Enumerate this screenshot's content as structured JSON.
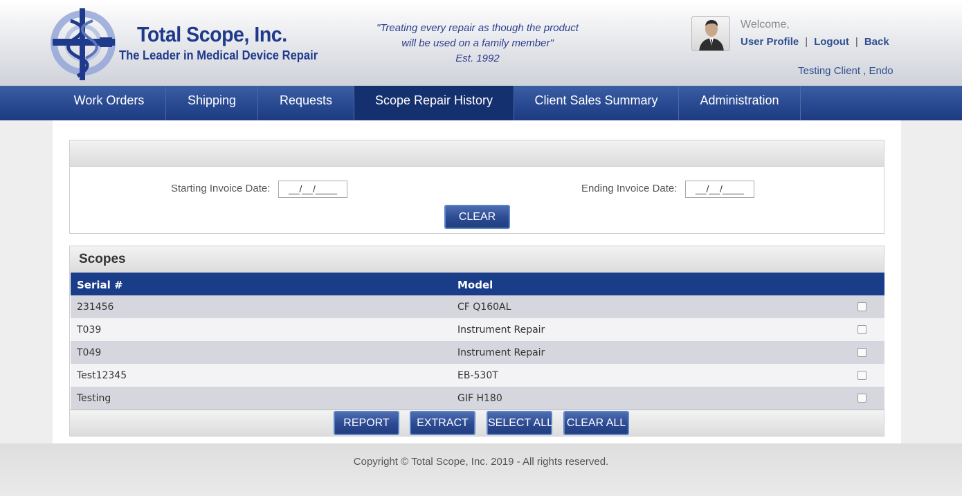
{
  "header": {
    "company_name": "Total Scope, Inc.",
    "company_tagline": "The Leader in Medical Device Repair",
    "motto_line1": "\"Treating every repair as though the product",
    "motto_line2": "will be used on a family member\"",
    "motto_line3": "Est. 1992",
    "welcome": "Welcome,",
    "user_profile": "User Profile",
    "separator": "|",
    "logout": "Logout",
    "back": "Back",
    "client_name": "Testing Client , Endo"
  },
  "nav": {
    "items": [
      {
        "label": "Work Orders"
      },
      {
        "label": "Shipping"
      },
      {
        "label": "Requests"
      },
      {
        "label": "Scope Repair History",
        "active": true
      },
      {
        "label": "Client Sales Summary"
      },
      {
        "label": "Administration"
      }
    ]
  },
  "filters": {
    "start_label": "Starting Invoice Date:",
    "start_value": "__/__/____",
    "end_label": "Ending Invoice Date:",
    "end_value": "__/__/____",
    "clear_button": "CLEAR"
  },
  "scopes": {
    "title": "Scopes",
    "columns": [
      "Serial #",
      "Model"
    ],
    "rows": [
      {
        "serial": "231456",
        "model": "CF Q160AL",
        "checked": false
      },
      {
        "serial": "T039",
        "model": "Instrument Repair",
        "checked": false
      },
      {
        "serial": "T049",
        "model": "Instrument Repair",
        "checked": false
      },
      {
        "serial": "Test12345",
        "model": "EB-530T",
        "checked": false
      },
      {
        "serial": "Testing",
        "model": "GIF H180",
        "checked": false
      }
    ],
    "buttons": {
      "report": "REPORT",
      "extract": "EXTRACT",
      "select_all": "SELECT ALL",
      "clear_all": "CLEAR ALL"
    }
  },
  "footer": {
    "copyright": "Copyright © Total Scope, Inc. 2019 - All rights reserved."
  },
  "colors": {
    "brand_blue": "#1f3a8a",
    "nav_blue": "#2a4b93",
    "table_header": "#1a3d8a"
  }
}
